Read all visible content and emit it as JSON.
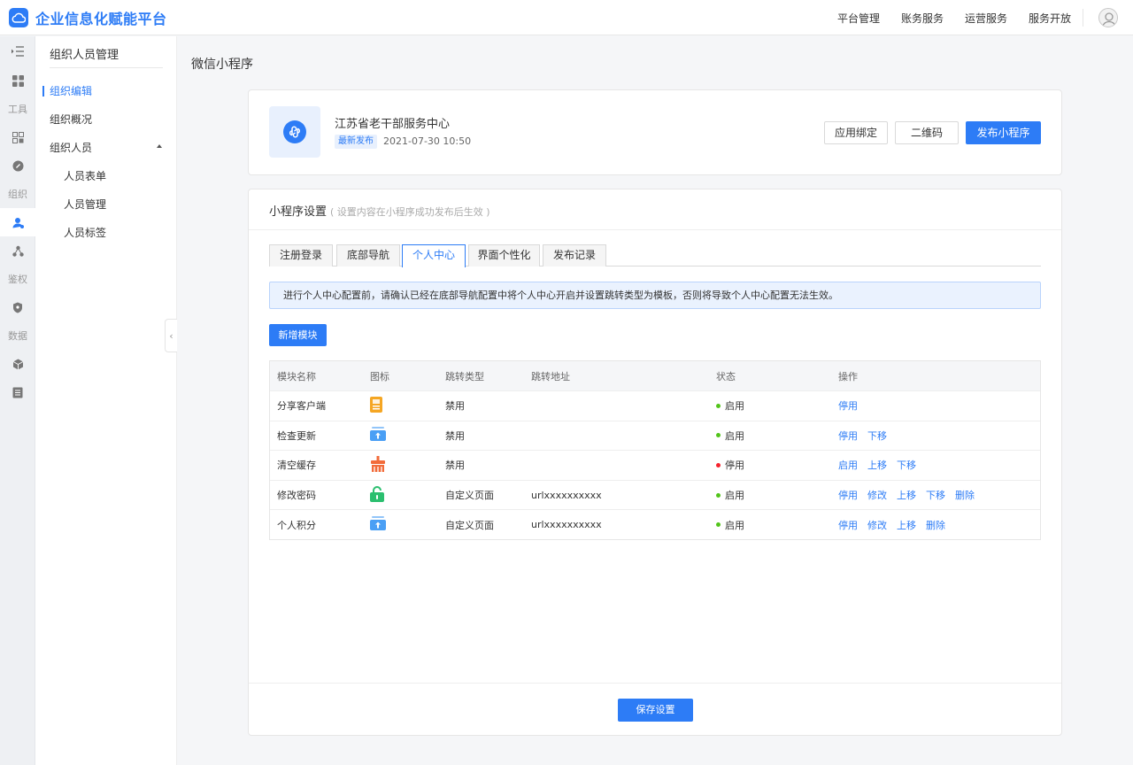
{
  "brand": {
    "name": "企业信息化赋能平台",
    "color": "#2d7cf6"
  },
  "top_nav": [
    "平台管理",
    "账务服务",
    "运营服务",
    "服务开放"
  ],
  "rail": {
    "labels": [
      "工具",
      "组织",
      "鉴权",
      "数据"
    ],
    "icons": [
      "menu-toggle-icon",
      "grid-icon",
      "app-grid-icon",
      "link-icon",
      "user-icon",
      "network-icon",
      "shield-icon",
      "cube-icon",
      "list-icon"
    ]
  },
  "sidebar": {
    "title": "组织人员管理",
    "items": [
      {
        "label": "组织编辑",
        "active": true
      },
      {
        "label": "组织概况",
        "active": false
      },
      {
        "label": "组织人员",
        "active": false,
        "expanded": true
      }
    ],
    "sub_items": [
      "人员表单",
      "人员管理",
      "人员标签"
    ]
  },
  "page": {
    "title": "微信小程序"
  },
  "app_card": {
    "name": "江苏省老干部服务中心",
    "badge": "最新发布",
    "time": "2021-07-30 10:50",
    "buttons": {
      "bind": "应用绑定",
      "qrcode": "二维码",
      "publish": "发布小程序"
    }
  },
  "settings": {
    "title": "小程序设置",
    "hint": "( 设置内容在小程序成功发布后生效 )",
    "tabs": [
      "注册登录",
      "底部导航",
      "个人中心",
      "界面个性化",
      "发布记录"
    ],
    "active_tab": 2,
    "notice": "进行个人中心配置前，请确认已经在底部导航配置中将个人中心开启并设置跳转类型为模板，否则将导致个人中心配置无法生效。",
    "add_button": "新增模块",
    "table": {
      "headers": [
        "模块名称",
        "图标",
        "跳转类型",
        "跳转地址",
        "状态",
        "操作"
      ],
      "rows": [
        {
          "name": "分享客户端",
          "icon": "share-client-icon",
          "icon_color": "#f5a623",
          "type": "禁用",
          "url": "",
          "status": "启用",
          "status_color": "#52c41a",
          "actions": [
            "停用"
          ]
        },
        {
          "name": "检查更新",
          "icon": "check-update-icon",
          "icon_color": "#4a9ff5",
          "type": "禁用",
          "url": "",
          "status": "启用",
          "status_color": "#52c41a",
          "actions": [
            "停用",
            "下移"
          ]
        },
        {
          "name": "清空缓存",
          "icon": "clear-cache-icon",
          "icon_color": "#f26b3a",
          "type": "禁用",
          "url": "",
          "status": "停用",
          "status_color": "#f5222d",
          "actions": [
            "启用",
            "上移",
            "下移"
          ]
        },
        {
          "name": "修改密码",
          "icon": "change-password-icon",
          "icon_color": "#2bbf6f",
          "type": "自定义页面",
          "url": "urlxxxxxxxxxx",
          "status": "启用",
          "status_color": "#52c41a",
          "actions": [
            "停用",
            "修改",
            "上移",
            "下移",
            "删除"
          ]
        },
        {
          "name": "个人积分",
          "icon": "points-icon",
          "icon_color": "#4a9ff5",
          "type": "自定义页面",
          "url": "urlxxxxxxxxxx",
          "status": "启用",
          "status_color": "#52c41a",
          "actions": [
            "停用",
            "修改",
            "上移",
            "删除"
          ]
        }
      ]
    },
    "save_button": "保存设置"
  }
}
